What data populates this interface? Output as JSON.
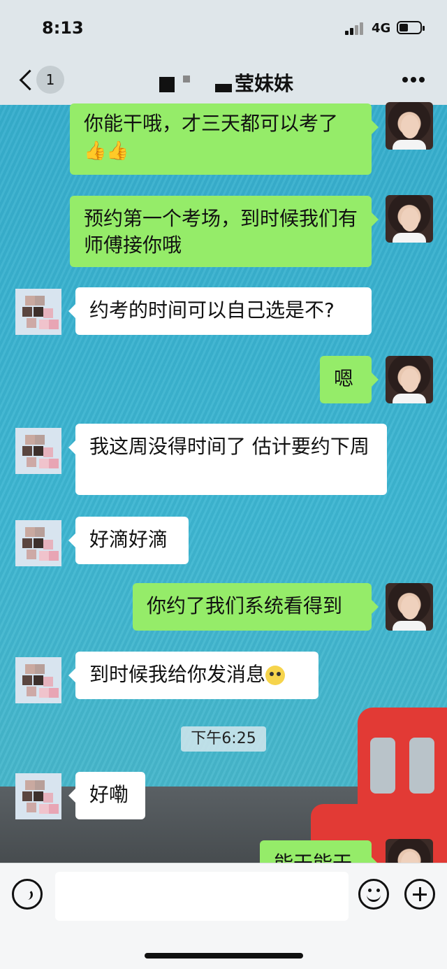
{
  "status_bar": {
    "time": "8:13",
    "network": "4G"
  },
  "nav": {
    "back_badge": "1",
    "title": "莹妹妹"
  },
  "messages": [
    {
      "side": "me",
      "text": "你能干哦，才三天都可以考了",
      "emoji": "👍👍"
    },
    {
      "side": "me",
      "text": "预约第一个考场，到时候我们有师傅接你哦"
    },
    {
      "side": "other",
      "text": "约考的时间可以自己选是不?"
    },
    {
      "side": "me",
      "text": "嗯"
    },
    {
      "side": "other",
      "text": "我这周没得时间了  估计要约下周"
    },
    {
      "side": "other",
      "text": "好滴好滴"
    },
    {
      "side": "me",
      "text": "你约了我们系统看得到"
    },
    {
      "side": "other",
      "text": "到时候我给你发消息",
      "emoji": "🤔"
    },
    {
      "side": "other",
      "text": "好嘞"
    },
    {
      "side": "me",
      "text": "能干能干"
    }
  ],
  "timestamp": "下午6:25",
  "input": {
    "placeholder": ""
  }
}
